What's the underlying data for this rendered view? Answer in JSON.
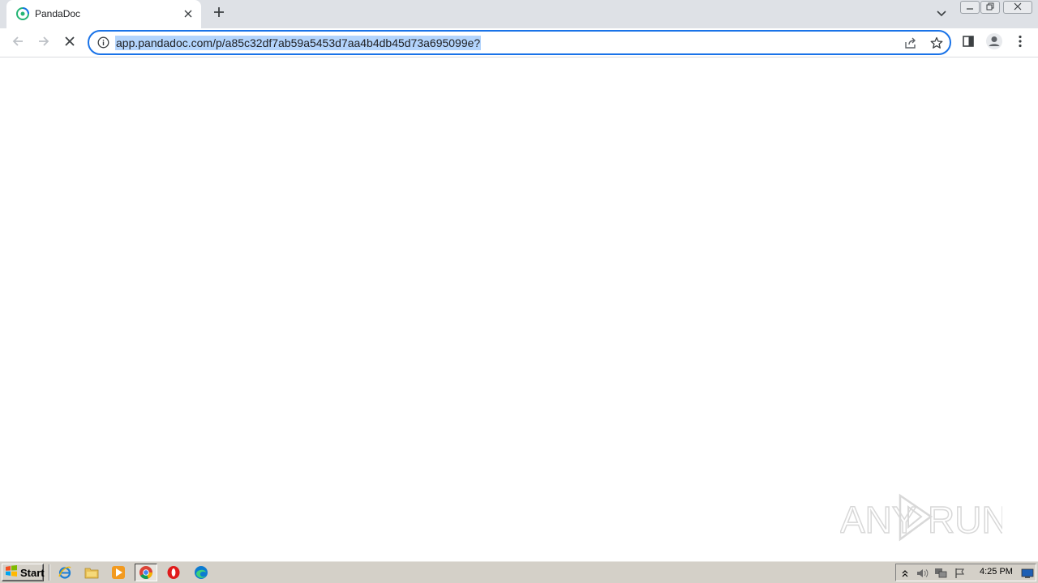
{
  "browser": {
    "tab": {
      "title": "PandaDoc",
      "favicon": "pandadoc-logo-icon",
      "close_icon": "close-icon"
    },
    "new_tab_icon": "plus-icon",
    "tab_search_icon": "chevron-down-icon",
    "window_controls": [
      "minimize-icon",
      "restore-icon",
      "close-icon"
    ],
    "toolbar": {
      "back_icon": "arrow-left-icon",
      "forward_icon": "arrow-right-icon",
      "stop_icon": "stop-loading-icon",
      "site_info_icon": "info-icon",
      "url": "app.pandadoc.com/p/a85c32df7ab59a5453d7aa4b4db45d73a695099e?",
      "share_icon": "share-icon",
      "bookmark_icon": "star-icon",
      "side_panel_icon": "side-panel-icon",
      "profile_icon": "profile-icon",
      "menu_icon": "kebab-menu-icon"
    },
    "accent_color": "#1a73e8",
    "selection_color": "#b3d4fc"
  },
  "watermark": {
    "text_left": "ANY",
    "text_right": "RUN"
  },
  "taskbar": {
    "start_label": "Start",
    "apps": [
      {
        "name": "internet-explorer-icon",
        "active": false
      },
      {
        "name": "file-explorer-icon",
        "active": false
      },
      {
        "name": "media-player-icon",
        "active": false
      },
      {
        "name": "chrome-icon",
        "active": true
      },
      {
        "name": "opera-icon",
        "active": false
      },
      {
        "name": "edge-icon",
        "active": false
      }
    ],
    "tray": {
      "icons": [
        "show-hidden-icons-icon",
        "volume-icon",
        "network-icon",
        "action-center-flag-icon"
      ],
      "clock": "4:25 PM",
      "show_desktop_icon": "show-desktop-icon"
    },
    "background_color": "#d4d0c8"
  }
}
